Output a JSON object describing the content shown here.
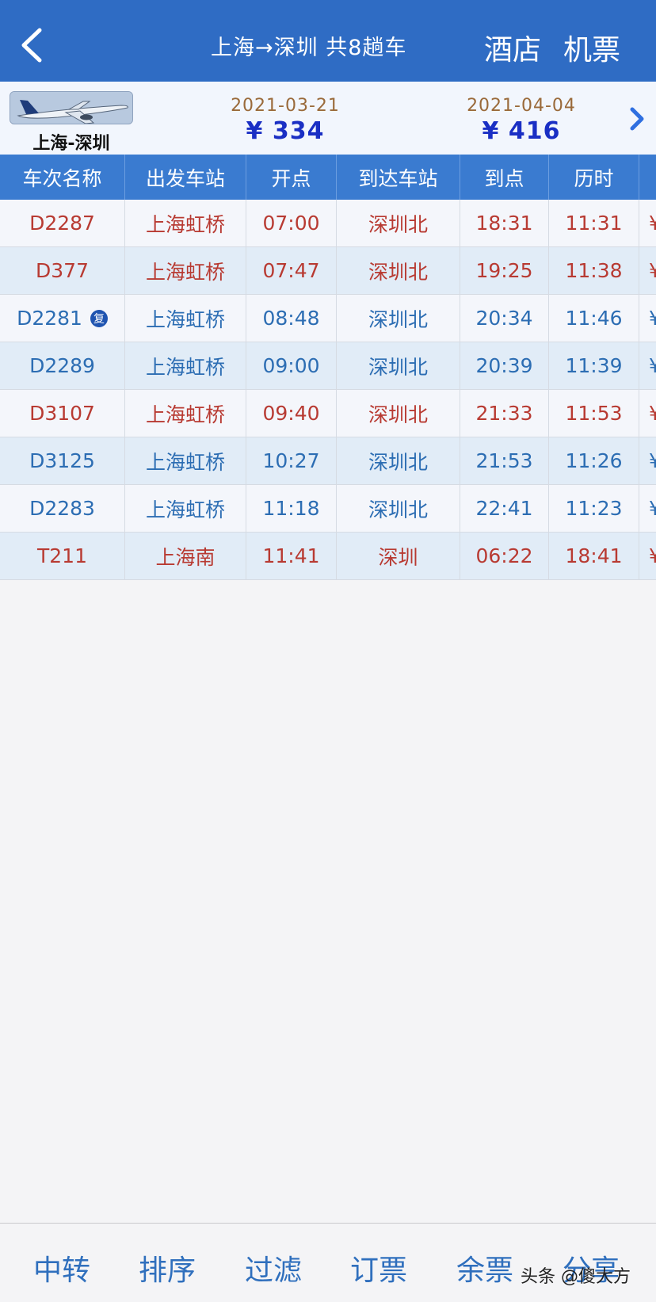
{
  "header": {
    "title": "上海→深圳 共8趟车",
    "hotel_label": "酒店",
    "flight_label": "机票"
  },
  "fare_strip": {
    "route_label": "上海-深圳",
    "fares": [
      {
        "date": "2021-03-21",
        "price": "¥ 334"
      },
      {
        "date": "2021-04-04",
        "price": "¥ 416"
      }
    ]
  },
  "table": {
    "headers": [
      "车次名称",
      "出发车站",
      "开点",
      "到达车站",
      "到点",
      "历时"
    ],
    "rows": [
      {
        "train": "D2287",
        "from": "上海虹桥",
        "dep": "07:00",
        "to": "深圳北",
        "arr": "18:31",
        "dur": "11:31",
        "price": "¥",
        "color": "red"
      },
      {
        "train": "D377",
        "from": "上海虹桥",
        "dep": "07:47",
        "to": "深圳北",
        "arr": "19:25",
        "dur": "11:38",
        "price": "¥",
        "color": "red"
      },
      {
        "train": "D2281",
        "badge": "复",
        "from": "上海虹桥",
        "dep": "08:48",
        "to": "深圳北",
        "arr": "20:34",
        "dur": "11:46",
        "price": "¥",
        "color": "blue"
      },
      {
        "train": "D2289",
        "from": "上海虹桥",
        "dep": "09:00",
        "to": "深圳北",
        "arr": "20:39",
        "dur": "11:39",
        "price": "¥",
        "color": "blue"
      },
      {
        "train": "D3107",
        "from": "上海虹桥",
        "dep": "09:40",
        "to": "深圳北",
        "arr": "21:33",
        "dur": "11:53",
        "price": "¥",
        "color": "red"
      },
      {
        "train": "D3125",
        "from": "上海虹桥",
        "dep": "10:27",
        "to": "深圳北",
        "arr": "21:53",
        "dur": "11:26",
        "price": "¥",
        "color": "blue"
      },
      {
        "train": "D2283",
        "from": "上海虹桥",
        "dep": "11:18",
        "to": "深圳北",
        "arr": "22:41",
        "dur": "11:23",
        "price": "¥",
        "color": "blue"
      },
      {
        "train": "T211",
        "from": "上海南",
        "dep": "11:41",
        "to": "深圳",
        "arr": "06:22",
        "dur": "18:41",
        "price": "¥",
        "color": "red"
      }
    ]
  },
  "toolbar": {
    "items": [
      "中转",
      "排序",
      "过滤",
      "订票",
      "余票",
      "分享"
    ]
  },
  "watermark": "头条 @傻大方",
  "colors": {
    "header_bg": "#2f6cc4",
    "table_head_bg": "#3a7bd0",
    "red_text": "#b83a32",
    "blue_text": "#2c6db3",
    "price_text": "#1a2fc4"
  },
  "icons": {
    "back": "chevron-left-icon",
    "next": "chevron-right-icon",
    "plane": "airplane-thumbnail",
    "badge": "fuxing-badge"
  }
}
